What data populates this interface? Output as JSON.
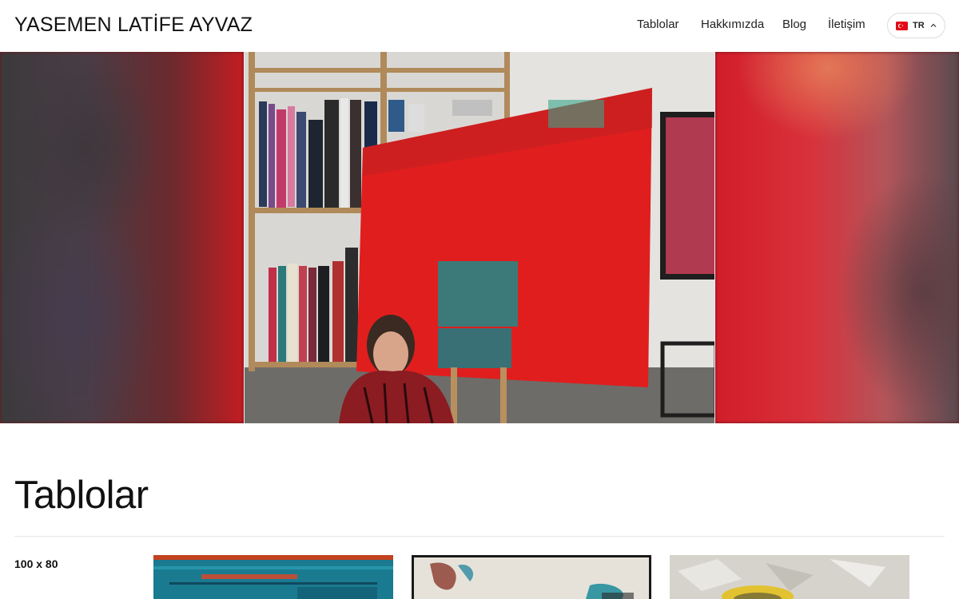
{
  "header": {
    "brand": "YASEMEN LATİFE AYVAZ",
    "nav": [
      "Tablolar",
      "Hakkımızda",
      "Blog",
      "İletişim"
    ],
    "language": {
      "code": "TR",
      "flag_icon": "turkey-flag-icon",
      "chevron_icon": "chevron-up-icon"
    }
  },
  "hero": {
    "image": "artist-studio-photo",
    "colors": {
      "painting_red": "#e01e1e",
      "wall": "#d8d6d2"
    }
  },
  "section": {
    "title": "Tablolar",
    "groups": [
      {
        "size_label": "100 x 80",
        "thumbnails": [
          "painting-thumbnail-1",
          "painting-thumbnail-2",
          "painting-thumbnail-3"
        ]
      }
    ]
  }
}
